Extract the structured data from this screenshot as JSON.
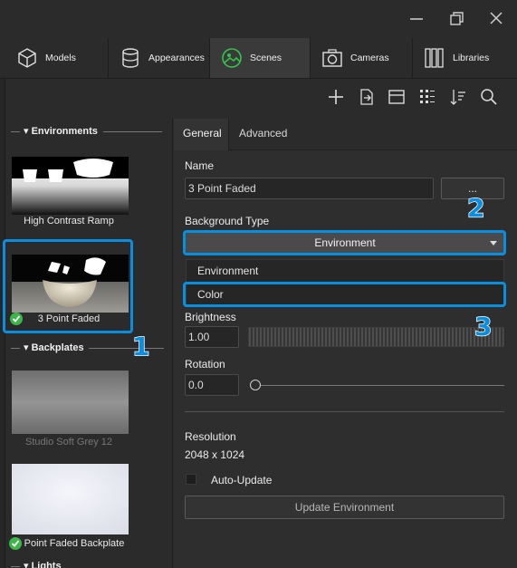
{
  "tabs": [
    {
      "label": "Models",
      "icon": "cube-icon"
    },
    {
      "label": "Appearances",
      "icon": "cylinder-icon"
    },
    {
      "label": "Scenes",
      "icon": "scene-icon",
      "active": true
    },
    {
      "label": "Cameras",
      "icon": "camera-icon"
    },
    {
      "label": "Libraries",
      "icon": "books-icon"
    }
  ],
  "toolbar": [
    "add-icon",
    "import-icon",
    "window-icon",
    "grid-icon",
    "sort-icon",
    "search-icon"
  ],
  "left": {
    "environments_label": "Environments",
    "env_items": [
      {
        "label": "High Contrast Ramp"
      },
      {
        "label": "3 Point Faded",
        "selected": true,
        "checked": true
      }
    ],
    "backplates_label": "Backplates",
    "backplate_items": [
      {
        "label": "Studio Soft Grey 12",
        "dim": true
      },
      {
        "label": "Point Faded Backplate",
        "checked": true
      }
    ],
    "lights_label": "Lights"
  },
  "right": {
    "tabs": [
      "General",
      "Advanced"
    ],
    "name_label": "Name",
    "name_value": "3 Point Faded",
    "more_button": "...",
    "bg_type_label": "Background Type",
    "bg_type_value": "Environment",
    "bg_options": [
      "Environment",
      "Color"
    ],
    "brightness_label": "Brightness",
    "brightness_value": "1.00",
    "rotation_label": "Rotation",
    "rotation_value": "0.0",
    "resolution_label": "Resolution",
    "resolution_value": "2048 x 1024",
    "auto_update_label": "Auto-Update",
    "update_button": "Update Environment"
  },
  "callouts": [
    "1",
    "2",
    "3"
  ],
  "colors": {
    "accent": "#0a8fe0",
    "check": "#3cb54a",
    "scenes_icon": "#35c24a"
  }
}
